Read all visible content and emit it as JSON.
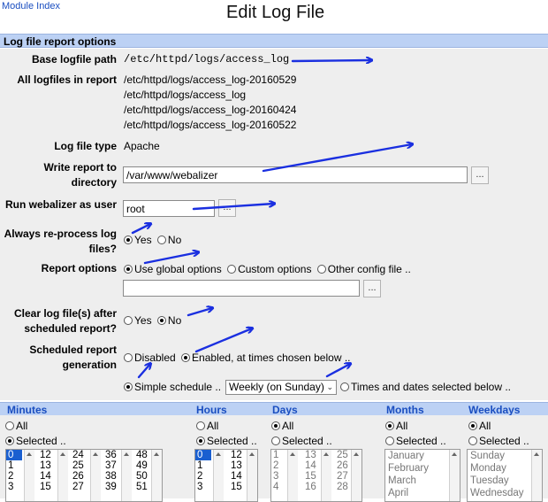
{
  "nav": {
    "module_index": "Module Index"
  },
  "page": {
    "title": "Edit Log File"
  },
  "section": {
    "title": "Log file report options"
  },
  "fields": {
    "base_logfile": {
      "label": "Base logfile path",
      "value": "/etc/httpd/logs/access_log"
    },
    "all_logfiles": {
      "label": "All logfiles in report",
      "values": [
        "/etc/httpd/logs/access_log-20160529",
        "/etc/httpd/logs/access_log",
        "/etc/httpd/logs/access_log-20160424",
        "/etc/httpd/logs/access_log-20160522"
      ]
    },
    "log_type": {
      "label": "Log file type",
      "value": "Apache"
    },
    "write_dir": {
      "label_line1": "Write report to",
      "label_line2": "directory",
      "value": "/var/www/webalizer",
      "button": "..."
    },
    "run_user": {
      "label": "Run webalizer as user",
      "value": "root",
      "button": "..."
    },
    "reprocess": {
      "label_line1": "Always re-process log",
      "label_line2": "files?",
      "yes": "Yes",
      "no": "No",
      "selected": "yes"
    },
    "report_options": {
      "label": "Report options",
      "global": "Use global options",
      "custom": "Custom options",
      "other": "Other config file ..",
      "selected": "global",
      "config_value": "",
      "button": "..."
    },
    "clear_logs": {
      "label_line1": "Clear log file(s) after",
      "label_line2": "scheduled report?",
      "yes": "Yes",
      "no": "No",
      "selected": "no"
    },
    "sched_gen": {
      "label_line1": "Scheduled report",
      "label_line2": "generation",
      "disabled": "Disabled",
      "enabled": "Enabled, at times chosen below ..",
      "selected": "enabled"
    },
    "schedule_mode": {
      "simple": "Simple schedule ..",
      "simple_value": "Weekly (on Sunday)",
      "times": "Times and dates selected below ..",
      "selected": "simple"
    }
  },
  "schedule": {
    "headers": {
      "minutes": "Minutes",
      "hours": "Hours",
      "days": "Days",
      "months": "Months",
      "weekdays": "Weekdays"
    },
    "all_label": "All",
    "selected_label": "Selected ..",
    "minutes_cols": [
      [
        "0",
        "1",
        "2",
        "3"
      ],
      [
        "12",
        "13",
        "14",
        "15"
      ],
      [
        "24",
        "25",
        "26",
        "27"
      ],
      [
        "36",
        "37",
        "38",
        "39"
      ],
      [
        "48",
        "49",
        "50",
        "51"
      ]
    ],
    "hours_cols": [
      [
        "0",
        "1",
        "2",
        "3"
      ],
      [
        "12",
        "13",
        "14",
        "15"
      ]
    ],
    "days_cols": [
      [
        "1",
        "2",
        "3",
        "4"
      ],
      [
        "13",
        "14",
        "15",
        "16"
      ],
      [
        "25",
        "26",
        "27",
        "28"
      ]
    ],
    "months": [
      "January",
      "February",
      "March",
      "April"
    ],
    "weekdays": [
      "Sunday",
      "Monday",
      "Tuesday",
      "Wednesday"
    ],
    "minutes_mode": "selected",
    "hours_mode": "selected",
    "days_mode": "all",
    "months_mode": "all",
    "weekdays_mode": "all"
  },
  "colors": {
    "header_bg": "#bcd1f4",
    "link": "#1a4ec0",
    "annotation_arrow": "#1a2fe0",
    "form_bg": "#eeeeee",
    "selection": "#1a5fd0"
  }
}
